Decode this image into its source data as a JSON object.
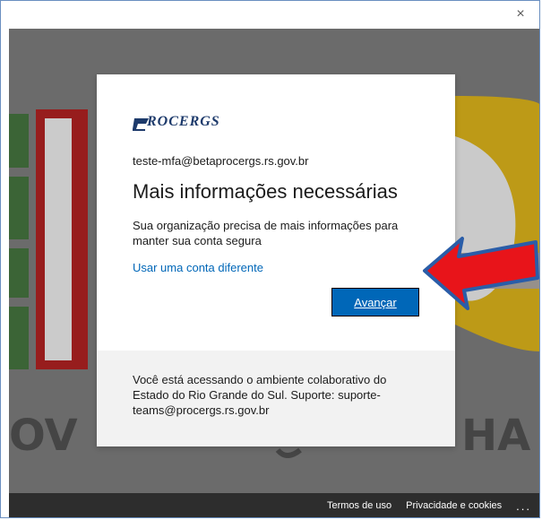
{
  "window": {
    "close_glyph": "×"
  },
  "dialog": {
    "logo_text": "ROCERGS",
    "email": "teste-mfa@betaprocergs.rs.gov.br",
    "title": "Mais informações necessárias",
    "description": "Sua organização precisa de mais informações para manter sua conta segura",
    "alt_account_link": "Usar uma conta diferente",
    "next_button": "Avançar",
    "info_text": "Você está acessando o ambiente colaborativo do Estado do Rio Grande do Sul. Suporte: suporte-teams@procergs.rs.gov.br"
  },
  "footer": {
    "terms": "Termos de uso",
    "privacy": "Privacidade e cookies",
    "more": "..."
  },
  "colors": {
    "accent": "#0067b8",
    "footer_bg": "#2d2d2d",
    "arrow_red": "#e8141a",
    "arrow_outline": "#2a5da8"
  },
  "icons": {
    "close": "close-icon",
    "arrow": "red-arrow-annotation"
  }
}
